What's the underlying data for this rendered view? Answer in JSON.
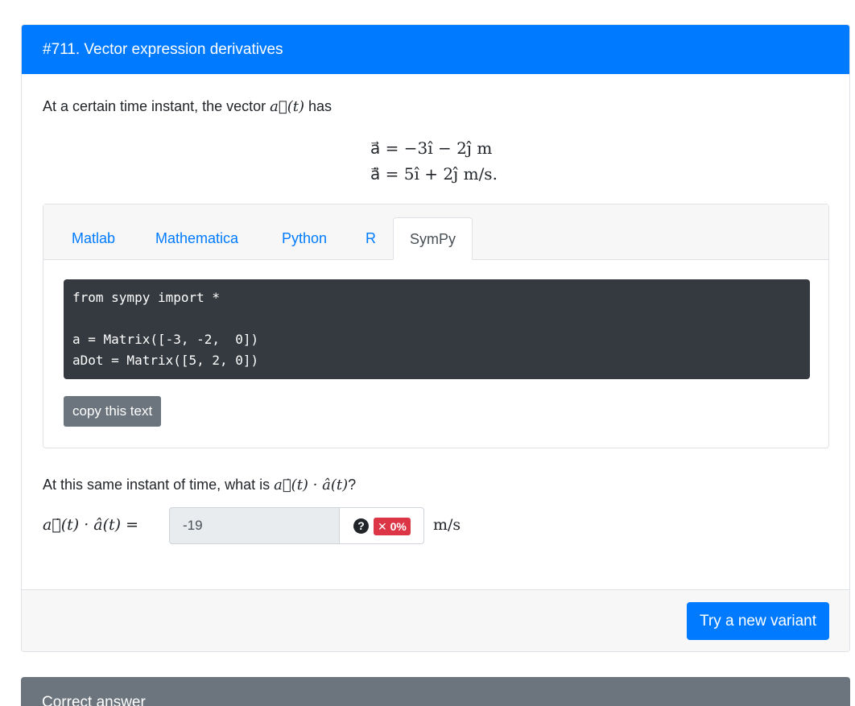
{
  "card": {
    "title": "#711. Vector expression derivatives",
    "intro_text": "At a certain time instant, the vector",
    "intro_vector": "a⃗(t)",
    "intro_suffix": "has",
    "equations": [
      "a⃗ = −3î − 2ĵ m",
      "a⃗̇ = 5î + 2ĵ m/s."
    ],
    "tabs": [
      {
        "label": "Matlab"
      },
      {
        "label": "Mathematica"
      },
      {
        "label": "Python"
      },
      {
        "label": "R"
      },
      {
        "label": "SymPy",
        "active": true
      }
    ],
    "code": "from sympy import *\n\na = Matrix([-3, -2,  0])\naDot = Matrix([5, 2, 0])",
    "copy_label": "copy this text",
    "question_text": "At this same instant of time, what is",
    "question_expr": "a⃗̇(t) · â(t)",
    "question_suffix": "?",
    "answer_label": "a⃗̇(t) · â(t) =",
    "answer_value": "-19",
    "help_glyph": "?",
    "score_badge": "✕ 0%",
    "unit": "m/s",
    "variant_label": "Try a new variant"
  },
  "card2": {
    "title": "Correct answer"
  },
  "colors": {
    "primary": "#007bff",
    "secondary": "#6c757d",
    "danger": "#dc3545",
    "code_bg": "#343a40"
  }
}
